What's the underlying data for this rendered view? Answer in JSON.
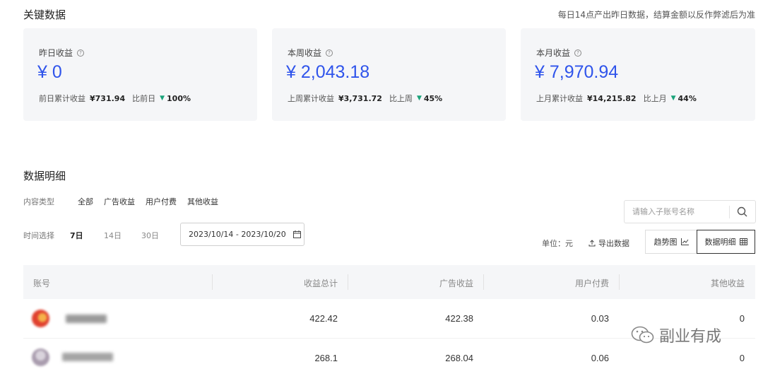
{
  "key_data": {
    "title": "关键数据",
    "note": "每日14点产出昨日数据，结算金额以反作弊滤后为准",
    "cards": [
      {
        "label": "昨日收益",
        "value": "¥ 0",
        "compare_label": "前日累计收益",
        "compare_value": "¥731.94",
        "ratio_label": "比前日",
        "ratio_value": "100%"
      },
      {
        "label": "本周收益",
        "value": "¥ 2,043.18",
        "compare_label": "上周累计收益",
        "compare_value": "¥3,731.72",
        "ratio_label": "比上周",
        "ratio_value": "45%"
      },
      {
        "label": "本月收益",
        "value": "¥ 7,970.94",
        "compare_label": "上月累计收益",
        "compare_value": "¥14,215.82",
        "ratio_label": "比上月",
        "ratio_value": "44%"
      }
    ]
  },
  "detail": {
    "title": "数据明细",
    "content_type_label": "内容类型",
    "content_types": [
      "全部",
      "广告收益",
      "用户付费",
      "其他收益"
    ],
    "time_label": "时间选择",
    "time_options": [
      "7日",
      "14日",
      "30日"
    ],
    "active_time": "7日",
    "date_range": "2023/10/14 - 2023/10/20",
    "search_placeholder": "请输入子账号名称",
    "unit": "单位：元",
    "export": "导出数据",
    "trend_button": "趋势图",
    "detail_button": "数据明细"
  },
  "table": {
    "columns": [
      "账号",
      "收益总计",
      "广告收益",
      "用户付费",
      "其他收益"
    ],
    "rows": [
      {
        "total": "422.42",
        "ad": "422.38",
        "paid": "0.03",
        "other": "0"
      },
      {
        "total": "268.1",
        "ad": "268.04",
        "paid": "0.06",
        "other": "0"
      }
    ]
  },
  "watermark": "副业有成",
  "colors": {
    "accent": "#2f54eb",
    "down": "#1aa37a"
  }
}
